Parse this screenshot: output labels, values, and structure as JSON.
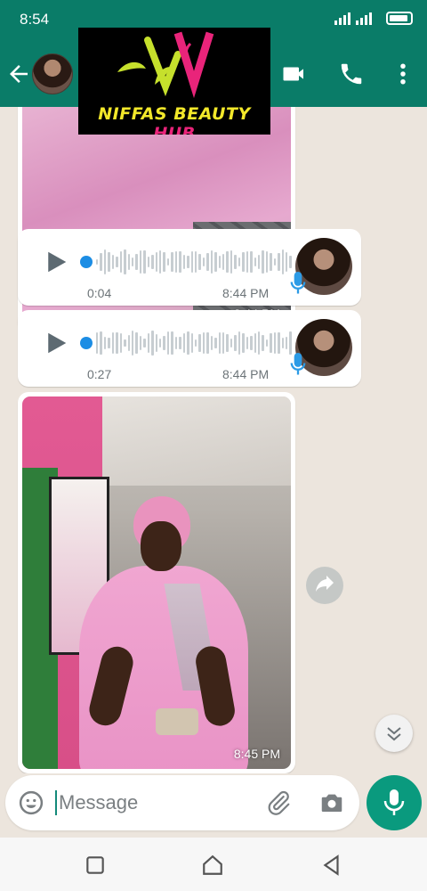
{
  "status_bar": {
    "time": "8:54"
  },
  "brand": {
    "name_part1": "NIFFAS BEAUTY ",
    "name_part2": "HUB"
  },
  "messages": [
    {
      "type": "image",
      "timestamp": "8:44 PM"
    },
    {
      "type": "voice",
      "duration": "0:04",
      "timestamp": "8:44 PM"
    },
    {
      "type": "voice",
      "duration": "0:27",
      "timestamp": "8:44 PM"
    },
    {
      "type": "image",
      "timestamp": "8:45 PM"
    }
  ],
  "composer": {
    "placeholder": "Message"
  },
  "colors": {
    "header": "#0a7c68",
    "accent": "#0a9a7e",
    "voice_dot": "#1c8de4",
    "chat_bg": "#ece5dd"
  },
  "icons": [
    "back-arrow-icon",
    "video-call-icon",
    "phone-icon",
    "more-options-icon",
    "play-icon",
    "mic-icon",
    "share-icon",
    "chevron-down-icon",
    "emoji-icon",
    "attach-icon",
    "camera-icon",
    "nav-recent-icon",
    "nav-home-icon",
    "nav-back-icon"
  ]
}
